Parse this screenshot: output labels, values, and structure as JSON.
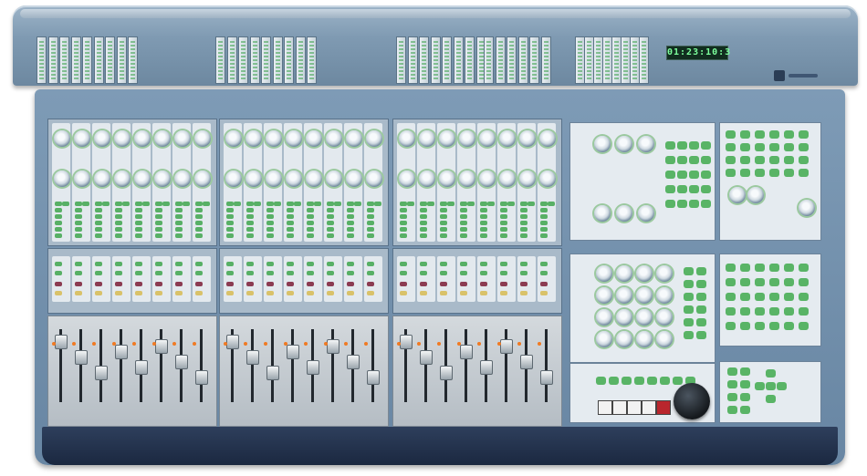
{
  "photo": {
    "subject": "",
    "meterbridge": {
      "timecode_display": "01:23:10:3"
    },
    "colors": {
      "frame": "#7e9bb6",
      "meterbridge": "#8aa4bb",
      "armrest": "#243450",
      "button_green": "#58b066",
      "button_red": "#8c3c52",
      "fader_led": "#f07a24"
    },
    "icons": [
      "knob-icon",
      "fader-icon",
      "jog-wheel-icon",
      "transport-play-icon",
      "transport-stop-icon",
      "transport-record-icon"
    ]
  }
}
